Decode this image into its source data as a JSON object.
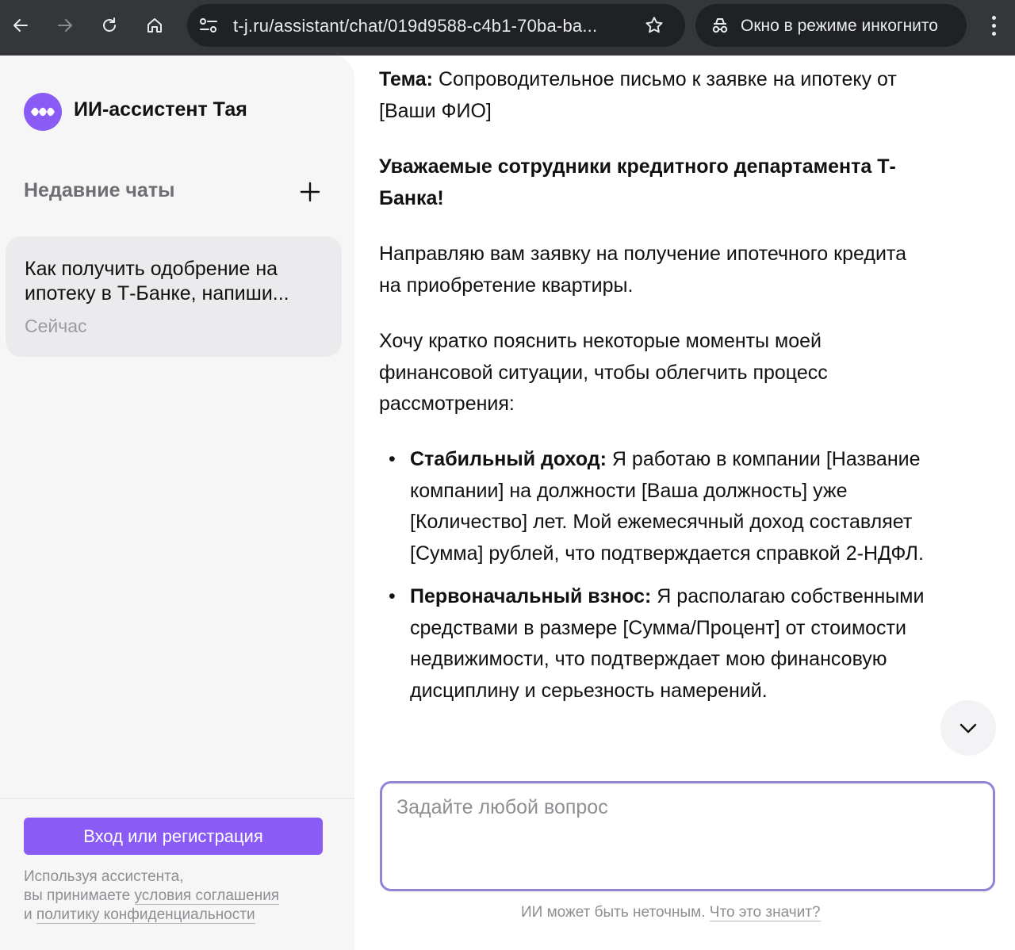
{
  "browser": {
    "url": "t-j.ru/assistant/chat/019d9588-c4b1-70ba-ba...",
    "incognito_label": "Окно в режиме инкогнито",
    "icons": [
      "back-arrow-icon",
      "forward-arrow-icon",
      "reload-icon",
      "home-icon",
      "site-settings-icon",
      "bookmark-star-icon",
      "incognito-icon",
      "menu-dots-icon"
    ]
  },
  "sidebar": {
    "brand": "ИИ-ассистент Тая",
    "recent_title": "Недавние чаты",
    "chats": [
      {
        "title": "Как получить одобрение на ипотеку в Т-Банке, напиши...",
        "time": "Сейчас"
      }
    ],
    "login_button": "Вход или регистрация",
    "legal": {
      "line1": "Используя ассистента,",
      "line2_prefix": "вы принимаете ",
      "line2_link": "условия соглашения",
      "line3_prefix": "и ",
      "line3_link": "политику конфиденциальности"
    }
  },
  "message": {
    "subject_label": "Тема:",
    "subject_text": " Сопроводительное письмо к заявке на ипотеку от [Ваши ФИО]",
    "greeting": "Уважаемые сотрудники кредитного департамента Т-Банка!",
    "para1": "Направляю вам заявку на получение ипотечного кредита на приобретение квартиры.",
    "para2": "Хочу кратко пояснить некоторые моменты моей финансовой ситуации, чтобы облегчить процесс рассмотрения:",
    "bullets": [
      {
        "label": "Стабильный доход:",
        "text": " Я работаю в компании [Название компании] на должности [Ваша должность] уже [Количество] лет. Мой ежемесячный доход составляет [Сумма] рублей, что подтверждается справкой 2-НДФЛ."
      },
      {
        "label": "Первоначальный взнос:",
        "text": " Я располагаю собственными средствами в размере [Сумма/Процент] от стоимости недвижимости, что подтверждает мою финансовую дисциплину и серьезность намерений."
      }
    ]
  },
  "composer": {
    "placeholder": "Задайте любой вопрос",
    "value": ""
  },
  "disclaimer": {
    "text": "ИИ может быть неточным. ",
    "link": "Что это значит?"
  },
  "colors": {
    "accent": "#8a5cf5",
    "input_border": "#8f84d8",
    "chrome_bg": "#35363a",
    "sidebar_bg": "#f6f6f7"
  }
}
